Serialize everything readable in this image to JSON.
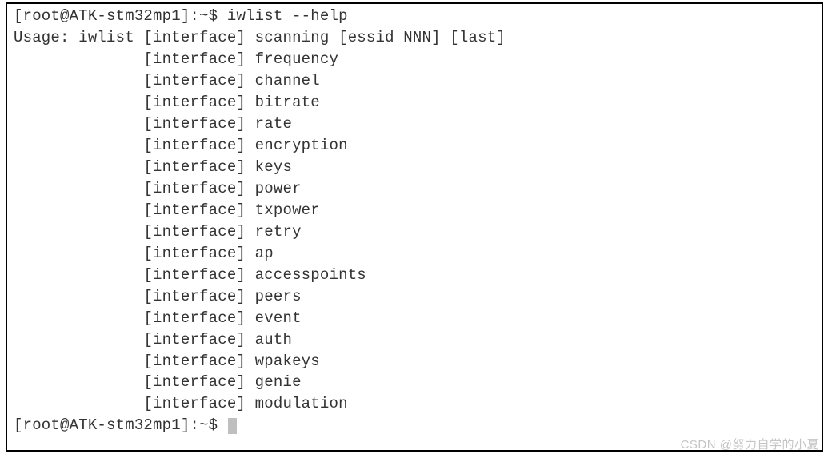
{
  "prompt": {
    "user": "root",
    "host": "ATK-stm32mp1",
    "path": "~",
    "symbol": "$",
    "full_open": "[root@ATK-stm32mp1]:~$ "
  },
  "command": "iwlist --help",
  "usage_prefix": "Usage: iwlist ",
  "usage_indent": "              ",
  "interface_token": "[interface] ",
  "first_line_suffix": "scanning [essid NNN] [last]",
  "options": [
    "frequency",
    "channel",
    "bitrate",
    "rate",
    "encryption",
    "keys",
    "power",
    "txpower",
    "retry",
    "ap",
    "accesspoints",
    "peers",
    "event",
    "auth",
    "wpakeys",
    "genie",
    "modulation"
  ],
  "watermark": "CSDN @努力自学的小夏"
}
